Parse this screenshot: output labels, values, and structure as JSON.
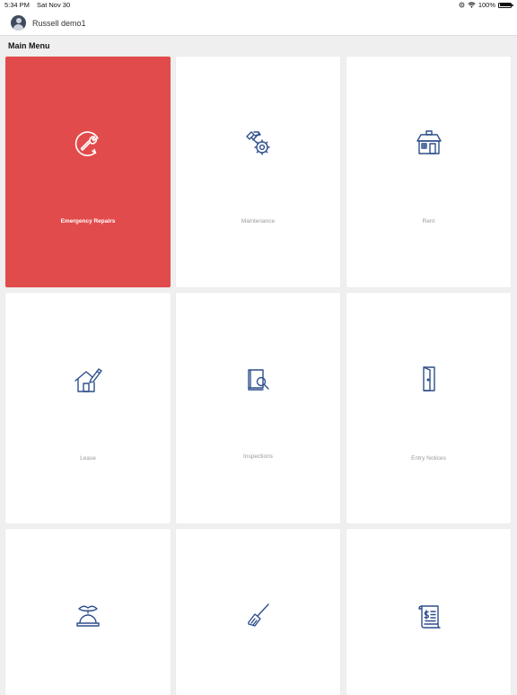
{
  "status_bar": {
    "time": "5:34 PM",
    "date": "Sat Nov 30",
    "battery_percent": "100%",
    "battery_level": 1.0
  },
  "header": {
    "user_name": "Russell demo1"
  },
  "main_menu": {
    "title": "Main Menu",
    "tiles": [
      {
        "label": "Emergency Repairs",
        "icon": "wrench-cycle-icon",
        "selected": true
      },
      {
        "label": "Maintenance",
        "icon": "tools-gear-icon",
        "selected": false
      },
      {
        "label": "Rent",
        "icon": "house-icon",
        "selected": false
      },
      {
        "label": "Lease",
        "icon": "house-pen-icon",
        "selected": false
      },
      {
        "label": "Inspections",
        "icon": "book-search-icon",
        "selected": false
      },
      {
        "label": "Entry Notices",
        "icon": "door-icon",
        "selected": false
      },
      {
        "label": "",
        "icon": "service-bell-icon",
        "selected": false
      },
      {
        "label": "",
        "icon": "broom-icon",
        "selected": false
      },
      {
        "label": "",
        "icon": "invoice-scroll-icon",
        "selected": false
      }
    ]
  },
  "colors": {
    "accent_red": "#e24b4b",
    "icon_blue": "#2e4f8c",
    "background": "#efefef",
    "tile": "#ffffff",
    "label_gray": "#9a9a9a"
  }
}
